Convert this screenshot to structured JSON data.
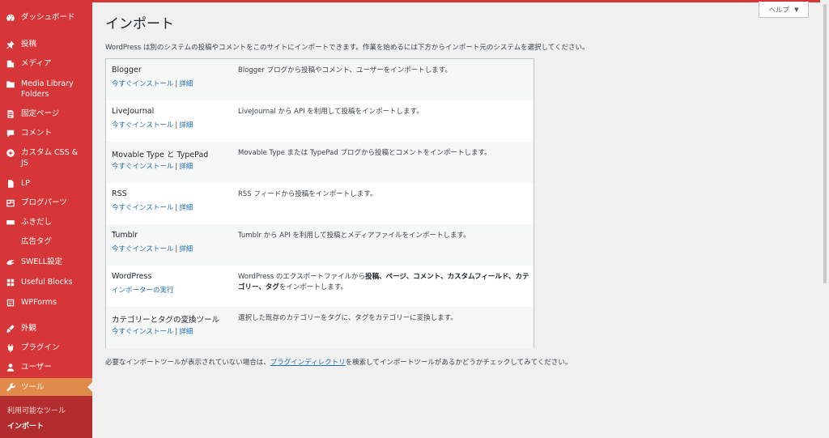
{
  "sidebar": {
    "items": [
      {
        "label": "ダッシュボード",
        "icon": "dashboard-icon"
      },
      {
        "label": "投稿",
        "icon": "pin-icon"
      },
      {
        "label": "メディア",
        "icon": "media-icon"
      },
      {
        "label": "Media Library",
        "label2": "Folders",
        "icon": "folders-icon"
      },
      {
        "label": "固定ページ",
        "icon": "page-icon"
      },
      {
        "label": "コメント",
        "icon": "comment-icon"
      },
      {
        "label": "カスタム CSS &",
        "label2": "JS",
        "icon": "plus-circle-icon"
      },
      {
        "label": "LP",
        "icon": "document-icon"
      },
      {
        "label": "ブログパーツ",
        "icon": "parts-icon"
      },
      {
        "label": "ふきだし",
        "icon": "balloon-icon"
      },
      {
        "label": "広告タグ",
        "icon": ""
      },
      {
        "label": "SWELL設定",
        "icon": "swell-icon"
      },
      {
        "label": "Useful Blocks",
        "icon": "blocks-icon"
      },
      {
        "label": "WPForms",
        "icon": "forms-icon"
      },
      {
        "label": "外観",
        "icon": "appearance-icon"
      },
      {
        "label": "プラグイン",
        "icon": "plugin-icon"
      },
      {
        "label": "ユーザー",
        "icon": "user-icon"
      },
      {
        "label": "ツール",
        "icon": "wrench-icon"
      }
    ],
    "submenu": {
      "available_tools": "利用可能なツール",
      "import": "インポート"
    }
  },
  "header": {
    "title": "インポート",
    "help": "ヘルプ"
  },
  "intro": "WordPress は別のシステムの投稿やコメントをこのサイトにインポートできます。作業を始めるには下方からインポート元のシステムを選択してください。",
  "importers": [
    {
      "name": "Blogger",
      "action": "今すぐインストール",
      "details": "詳細",
      "desc": "Blogger ブログから投稿やコメント、ユーザーをインポートします。"
    },
    {
      "name": "LiveJournal",
      "action": "今すぐインストール",
      "details": "詳細",
      "desc": "LiveJournal から API を利用して投稿をインポートします。"
    },
    {
      "name": "Movable Type と TypePad",
      "action": "今すぐインストール",
      "details": "詳細",
      "desc": "Movable Type または TypePad ブログから投稿とコメントをインポートします。"
    },
    {
      "name": "RSS",
      "action": "今すぐインストール",
      "details": "詳細",
      "desc": "RSS フィードから投稿をインポートします。"
    },
    {
      "name": "Tumblr",
      "action": "今すぐインストール",
      "details": "詳細",
      "desc": "Tumblr から API を利用して投稿とメディアファイルをインポートします。"
    },
    {
      "name": "WordPress",
      "action": "インポーターの実行",
      "details": "",
      "desc_parts": [
        "WordPress のエクスポートファイルから",
        "投稿、ページ、コメント、カスタムフィールド、カテゴリー、タグ",
        "をインポートします。"
      ]
    },
    {
      "name": "カテゴリーとタグの変換ツール",
      "action": "今すぐインストール",
      "details": "詳細",
      "desc": "選択した既存のカテゴリーをタグに、タグをカテゴリーに変換します。"
    }
  ],
  "footer": {
    "before": "必要なインポートツールが表示されていない場合は、",
    "link": "プラグインディレクトリ",
    "after": "を検索してインポートツールがあるかどうかチェックしてみてください。"
  },
  "colors": {
    "sidebar_bg": "#d63638",
    "current_menu_bg": "#e18b4a",
    "link": "#2271b1"
  }
}
